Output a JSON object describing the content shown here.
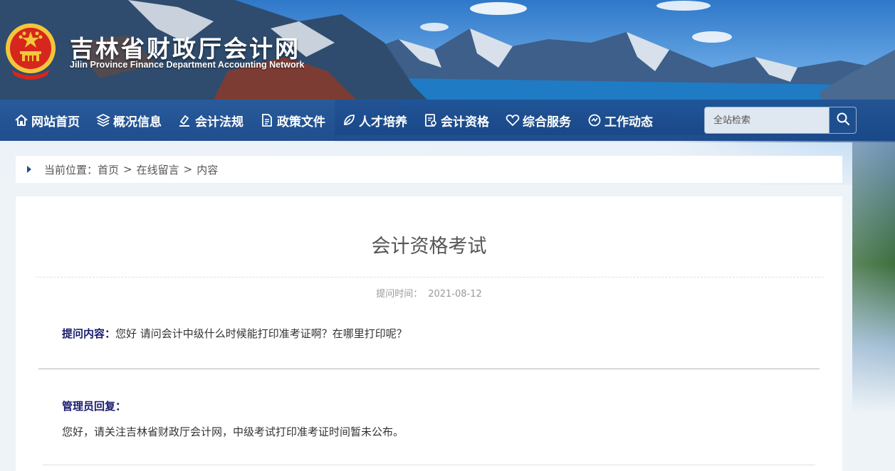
{
  "header": {
    "title": "吉林省财政厅会计网",
    "subtitle": "Jilin Province Finance Department Accounting Network"
  },
  "nav": {
    "items": [
      {
        "label": "网站首页",
        "icon": "home-icon"
      },
      {
        "label": "概况信息",
        "icon": "layers-icon"
      },
      {
        "label": "会计法规",
        "icon": "gavel-icon"
      },
      {
        "label": "政策文件",
        "icon": "document-icon"
      },
      {
        "label": "人才培养",
        "icon": "leaf-icon"
      },
      {
        "label": "会计资格",
        "icon": "certificate-icon"
      },
      {
        "label": "综合服务",
        "icon": "heart-icon"
      },
      {
        "label": "工作动态",
        "icon": "dynamic-icon"
      }
    ]
  },
  "search": {
    "placeholder": "全站检索",
    "icon": "search-icon"
  },
  "breadcrumb": {
    "prefix": "当前位置：",
    "items": [
      "首页",
      "在线留言",
      "内容"
    ],
    "separator": ">"
  },
  "question": {
    "title": "会计资格考试",
    "time_label": "提问时间：",
    "time_value": "2021-08-12",
    "content_label": "提问内容：",
    "content_text": "您好 请问会计中级什么时候能打印准考证啊？在哪里打印呢？"
  },
  "answer": {
    "label": "管理员回复：",
    "text": "您好，请关注吉林省财政厅会计网，中级考试打印准考证时间暂未公布。"
  },
  "colors": {
    "nav_bg": "#1d4f8f",
    "label_color": "#1a1a6e",
    "emblem_red": "#d7261d",
    "emblem_gold": "#f3c63b"
  }
}
